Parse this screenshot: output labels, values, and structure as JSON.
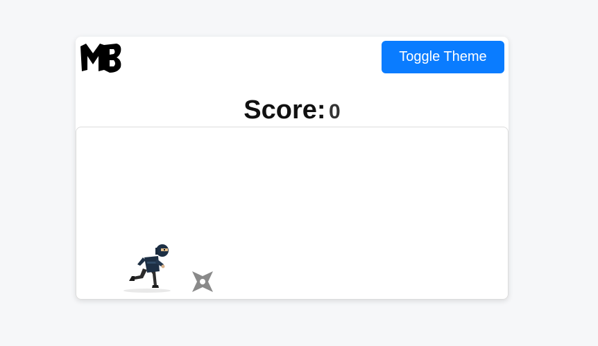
{
  "header": {
    "logo_text": "MB",
    "toggle_label": "Toggle Theme"
  },
  "score": {
    "label": "Score:",
    "value": "0"
  },
  "game": {
    "player": "ninja-runner",
    "obstacle": "shuriken-icon"
  },
  "colors": {
    "page_bg": "#f6f7f9",
    "card_bg": "#ffffff",
    "button_bg": "#0a7cff",
    "button_text": "#ffffff",
    "shuriken": "#8a8a8a"
  }
}
